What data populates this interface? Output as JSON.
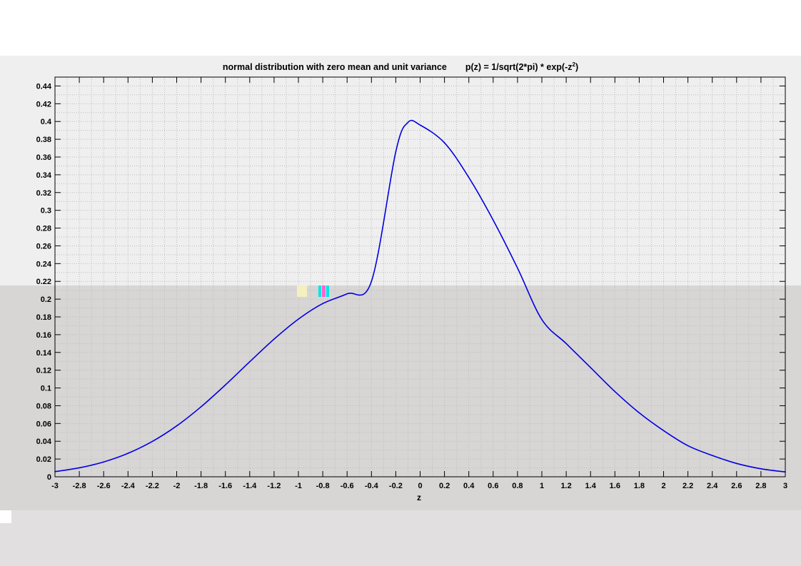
{
  "chart_data": {
    "type": "line",
    "title": "normal distribution with zero mean and unit variance",
    "subtitle_formula_prefix": "p(z) = 1/sqrt(2*pi) * exp(-z",
    "subtitle_formula_superscript": "2",
    "subtitle_formula_suffix": ")",
    "xlabel": "z",
    "ylabel": "",
    "xlim": [
      -3,
      3
    ],
    "ylim": [
      0,
      0.45
    ],
    "xticks": [
      -3,
      -2.8,
      -2.6,
      -2.4,
      -2.2,
      -2,
      -1.8,
      -1.6,
      -1.4,
      -1.2,
      -1,
      -0.8,
      -0.6,
      -0.4,
      -0.2,
      0,
      0.2,
      0.4,
      0.6,
      0.8,
      1,
      1.2,
      1.4,
      1.6,
      1.8,
      2,
      2.2,
      2.4,
      2.6,
      2.8,
      3
    ],
    "xtick_labels": [
      "-3",
      "-2.8",
      "-2.6",
      "-2.4",
      "-2.2",
      "-2",
      "-1.8",
      "-1.6",
      "-1.4",
      "-1.2",
      "-1",
      "-0.8",
      "-0.6",
      "-0.4",
      "-0.2",
      "0",
      "0.2",
      "0.4",
      "0.6",
      "0.8",
      "1",
      "1.2",
      "1.4",
      "1.6",
      "1.8",
      "2",
      "2.2",
      "2.4",
      "2.6",
      "2.8",
      "3"
    ],
    "yticks": [
      0,
      0.02,
      0.04,
      0.06,
      0.08,
      0.1,
      0.12,
      0.14,
      0.16,
      0.18,
      0.2,
      0.22,
      0.24,
      0.26,
      0.28,
      0.3,
      0.32,
      0.34,
      0.36,
      0.38,
      0.4,
      0.42,
      0.44
    ],
    "ytick_labels": [
      "0",
      "0.02",
      "0.04",
      "0.06",
      "0.08",
      "0.1",
      "0.12",
      "0.14",
      "0.16",
      "0.18",
      "0.2",
      "0.22",
      "0.24",
      "0.26",
      "0.28",
      "0.3",
      "0.32",
      "0.34",
      "0.36",
      "0.38",
      "0.4",
      "0.42",
      "0.44"
    ],
    "grid": true,
    "grid_style": "dotted",
    "series": [
      {
        "color": "#0000e0",
        "x": [
          -3,
          -2.8,
          -2.6,
          -2.4,
          -2.2,
          -2,
          -1.8,
          -1.6,
          -1.4,
          -1.2,
          -1,
          -0.8,
          -0.6,
          -0.4,
          -0.2,
          -0.1,
          0,
          0.2,
          0.4,
          0.6,
          0.8,
          1,
          1.2,
          1.4,
          1.6,
          1.8,
          2,
          2.2,
          2.4,
          2.6,
          2.8,
          3
        ],
        "y": [
          0.0058,
          0.0101,
          0.0167,
          0.0264,
          0.0398,
          0.0573,
          0.0788,
          0.1034,
          0.1295,
          0.155,
          0.1775,
          0.195,
          0.206,
          0.22,
          0.366,
          0.399,
          0.396,
          0.376,
          0.337,
          0.289,
          0.235,
          0.177,
          0.15,
          0.123,
          0.096,
          0.072,
          0.052,
          0.035,
          0.024,
          0.015,
          0.009,
          0.0055
        ]
      }
    ]
  },
  "colors": {
    "line": "#0000e0",
    "axes_background": "#ffffff",
    "grid": "#bdbdbd"
  }
}
